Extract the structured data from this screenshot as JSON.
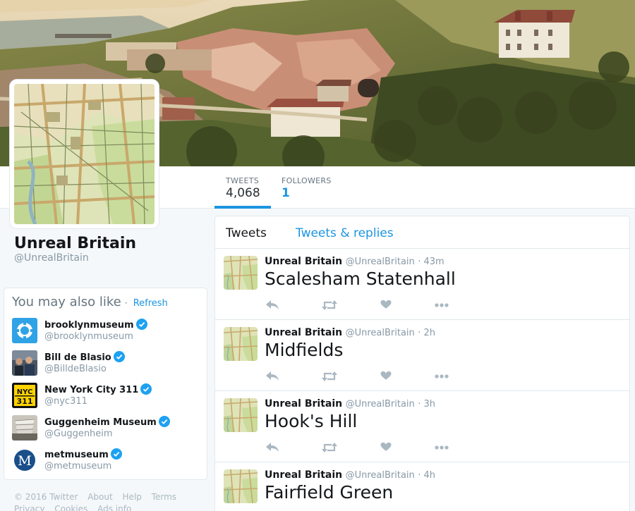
{
  "profile": {
    "name": "Unreal Britain",
    "handle": "@UnrealBritain"
  },
  "stats": {
    "tweets_label": "TWEETS",
    "tweets_value": "4,068",
    "followers_label": "FOLLOWERS",
    "followers_value": "1"
  },
  "timeline_tabs": {
    "tweets": "Tweets",
    "tweets_replies": "Tweets & replies"
  },
  "who_to_follow": {
    "title": "You may also like",
    "dot": "·",
    "refresh": "Refresh",
    "items": [
      {
        "name": "brooklynmuseum",
        "handle": "@brooklynmuseum"
      },
      {
        "name": "Bill de Blasio",
        "handle": "@BilldeBlasio"
      },
      {
        "name": "New York City 311",
        "handle": "@nyc311",
        "icon_text_1": "NYC",
        "icon_text_2": "311"
      },
      {
        "name": "Guggenheim Museum",
        "handle": "@Guggenheim"
      },
      {
        "name": "metmuseum",
        "handle": "@metmuseum",
        "icon_text": "M"
      }
    ]
  },
  "footer": {
    "copyright": "© 2016 Twitter",
    "about": "About",
    "help": "Help",
    "terms": "Terms",
    "privacy": "Privacy",
    "cookies": "Cookies",
    "ads": "Ads info"
  },
  "tweets": [
    {
      "author": "Unreal Britain",
      "handle": "@UnrealBritain",
      "time": "· 43m",
      "text": "Scalesham Statenhall"
    },
    {
      "author": "Unreal Britain",
      "handle": "@UnrealBritain",
      "time": "· 2h",
      "text": "Midfields"
    },
    {
      "author": "Unreal Britain",
      "handle": "@UnrealBritain",
      "time": "· 3h",
      "text": "Hook's Hill"
    },
    {
      "author": "Unreal Britain",
      "handle": "@UnrealBritain",
      "time": "· 4h",
      "text": "Fairfield Green"
    }
  ],
  "colors": {
    "accent": "#1b95e0",
    "verified": "#1da1f2"
  }
}
